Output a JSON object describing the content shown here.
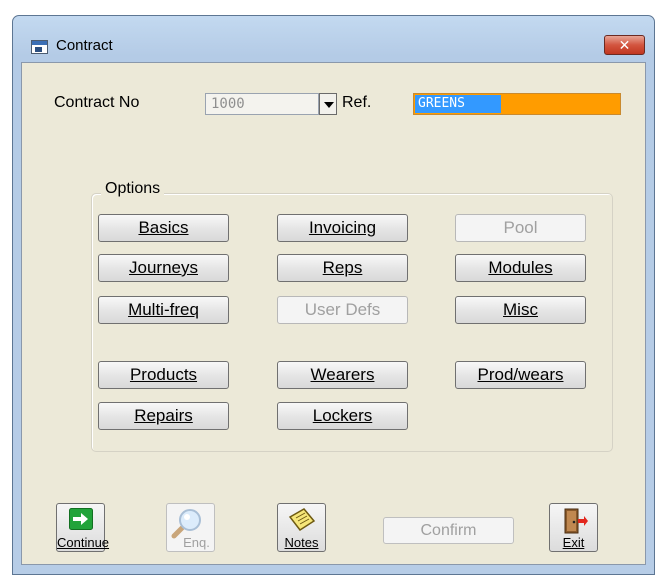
{
  "window": {
    "title": "Contract",
    "close_glyph": "✕"
  },
  "header": {
    "contract_label": "Contract No",
    "contract_value": "1000",
    "ref_label": "Ref.",
    "ref_value": "GREENS"
  },
  "options": {
    "title": "Options",
    "buttons": [
      {
        "label": "Basics",
        "enabled": true
      },
      {
        "label": "Invoicing",
        "enabled": true
      },
      {
        "label": "Pool",
        "enabled": false
      },
      {
        "label": "Journeys",
        "enabled": true
      },
      {
        "label": "Reps",
        "enabled": true
      },
      {
        "label": "Modules",
        "enabled": true
      },
      {
        "label": "Multi-freq",
        "enabled": true
      },
      {
        "label": "User Defs",
        "enabled": false
      },
      {
        "label": "Misc",
        "enabled": true
      },
      {
        "label": "Products",
        "enabled": true
      },
      {
        "label": "Wearers",
        "enabled": true
      },
      {
        "label": "Prod/wears",
        "enabled": true
      },
      {
        "label": "Repairs",
        "enabled": true
      },
      {
        "label": "Lockers",
        "enabled": true
      }
    ]
  },
  "toolbar": {
    "continue_label": "Continue",
    "enq_label": "Enq.",
    "notes_label": "Notes",
    "confirm_label": "Confirm",
    "exit_label": "Exit"
  },
  "icons": {
    "continue": "green-arrow-right-icon",
    "enq": "magnifier-icon",
    "notes": "notepad-icon",
    "exit": "door-exit-icon"
  },
  "colors": {
    "ref_selection": "#3399ff",
    "ref_background": "#ff9c00",
    "dialog_background": "#ece9d8",
    "close_button": "#c13620"
  }
}
